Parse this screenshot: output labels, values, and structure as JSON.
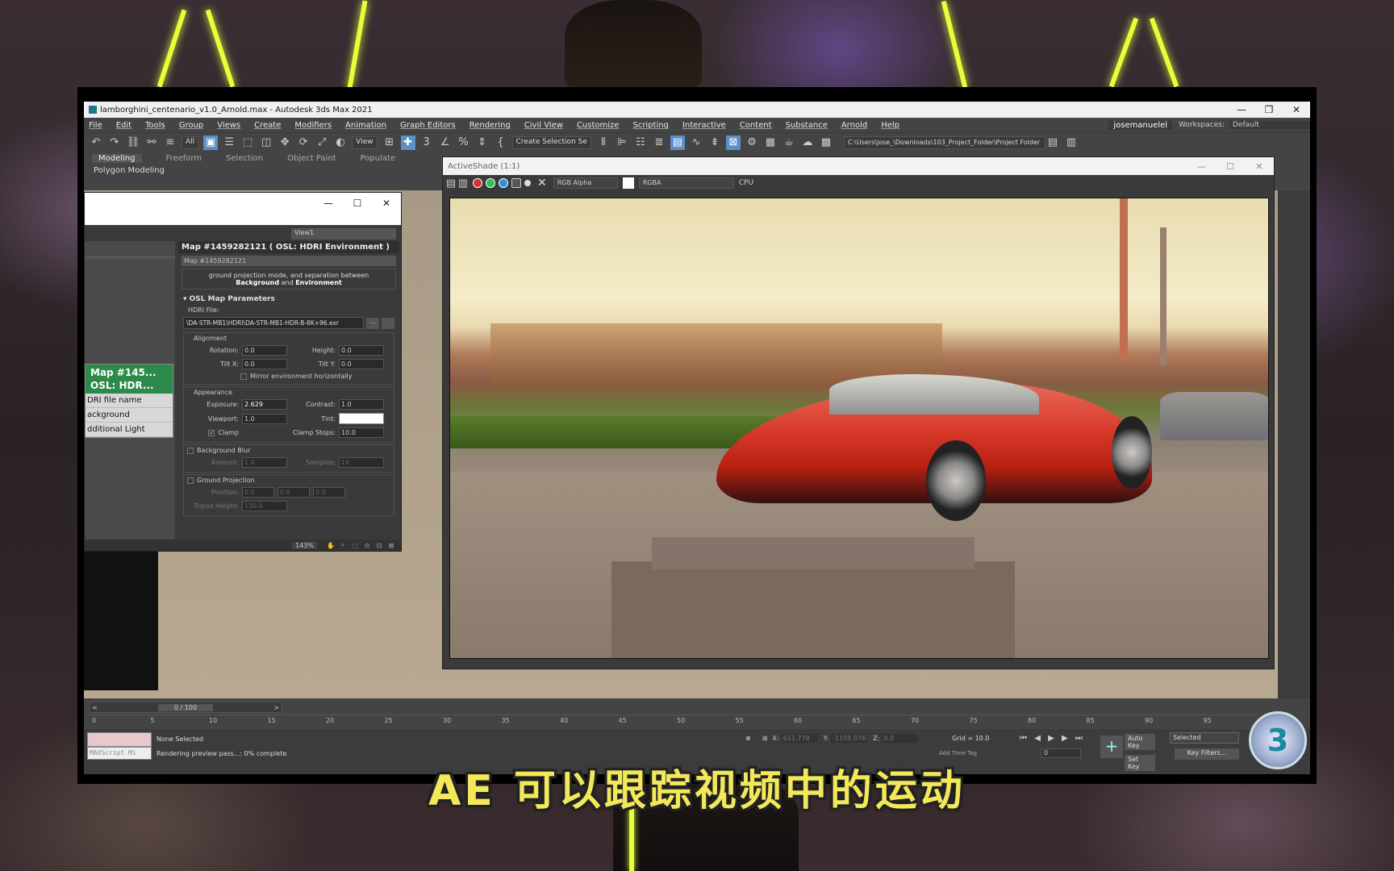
{
  "app": {
    "title": "lamborghini_centenario_v1.0_Arnold.max - Autodesk 3ds Max 2021",
    "controls": [
      "—",
      "❐",
      "✕"
    ]
  },
  "menu": {
    "items": [
      "File",
      "Edit",
      "Tools",
      "Group",
      "Views",
      "Create",
      "Modifiers",
      "Animation",
      "Graph Editors",
      "Rendering",
      "Civil View",
      "Customize",
      "Scripting",
      "Interactive",
      "Content",
      "Substance",
      "Arnold",
      "Help"
    ],
    "user": "josemanuelel",
    "workspaces_label": "Workspaces:",
    "workspaces_value": "Default"
  },
  "toolbar": {
    "filter_dropdown": "All",
    "view_dropdown": "View",
    "selection_set": "Create Selection Se",
    "project_path": "C:\\Users\\jose_\\Downloads\\103_Project_Folder\\Project Folder"
  },
  "ribbon": {
    "tabs": [
      "Modeling",
      "Freeform",
      "Selection",
      "Object Paint",
      "Populate"
    ],
    "sub_label": "Polygon Modeling"
  },
  "material_editor": {
    "view_dropdown": "View1",
    "map_header": "Map #1459282121  ( OSL: HDRI Environment )",
    "map_name": "Map #1459282121",
    "description_line1": "ground projection mode, and separation between",
    "description_bold1": "Background",
    "description_and": "and",
    "description_bold2": "Environment",
    "section_title": "OSL Map Parameters",
    "hdri_label": "HDRI File:",
    "hdri_path": "\\DA-STR-MB1\\HDRI\\DA-STR-MB1-HDR-B-8K+96.exr",
    "hdri_button": "...",
    "alignment_label": "Alignment",
    "rotation_label": "Rotation:",
    "rotation_value": "0.0",
    "height_label": "Height:",
    "height_value": "0.0",
    "tiltx_label": "Tilt X:",
    "tiltx_value": "0.0",
    "tilty_label": "Tilt Y:",
    "tilty_value": "0.0",
    "mirror_label": "Mirror environment horizontally",
    "appearance_label": "Appearance",
    "exposure_label": "Exposure:",
    "exposure_value": "2.629",
    "contrast_label": "Contrast:",
    "contrast_value": "1.0",
    "viewport_label": "Viewport:",
    "viewport_value": "1.0",
    "tint_label": "Tint:",
    "clamp_label": "Clamp",
    "clamp_stops_label": "Clamp Stops:",
    "clamp_stops_value": "10.0",
    "bg_blur_label": "Background Blur",
    "amount_label": "Amount:",
    "amount_value": "1.0",
    "samples_label": "Samples:",
    "samples_value": "16",
    "ground_proj_label": "Ground Projection",
    "position_label": "Position:",
    "position_values": [
      "0.0",
      "0.0",
      "0.0"
    ],
    "tripod_label": "Tripod Height:",
    "tripod_value": "150.0",
    "zoom": "143%",
    "node_title1": "Map  #145...",
    "node_title2": "OSL:  HDR...",
    "node_slots": [
      "DRI file name",
      "ackground",
      "dditional Light"
    ]
  },
  "activeshade": {
    "title": "ActiveShade (1:1)",
    "channel": "RGB Alpha",
    "format": "RGBA",
    "device": "CPU"
  },
  "timeline": {
    "frame_display": "0 / 100",
    "ticks": [
      "0",
      "5",
      "10",
      "15",
      "20",
      "25",
      "30",
      "35",
      "40",
      "45",
      "50",
      "55",
      "60",
      "65",
      "70",
      "75",
      "80",
      "85",
      "90",
      "95"
    ]
  },
  "status": {
    "maxscript_placeholder": "MAXScript Mi",
    "selection": "None Selected",
    "progress": "Rendering preview pass...: 0% complete",
    "x_label": "X:",
    "x_value": "611.778",
    "y_label": "Y:",
    "y_value": "-1105.076",
    "z_label": "Z:",
    "z_value": "0.0",
    "grid": "Grid = 10.0",
    "add_time_tag": "Add Time Tag",
    "auto_key": "Auto Key",
    "set_key": "Set Key",
    "key_mode": "Selected",
    "key_filters": "Key Filters...",
    "current_frame": "0"
  },
  "overlay": {
    "subtitle": "AE  可以跟踪视频中的运动",
    "badge": "3"
  }
}
